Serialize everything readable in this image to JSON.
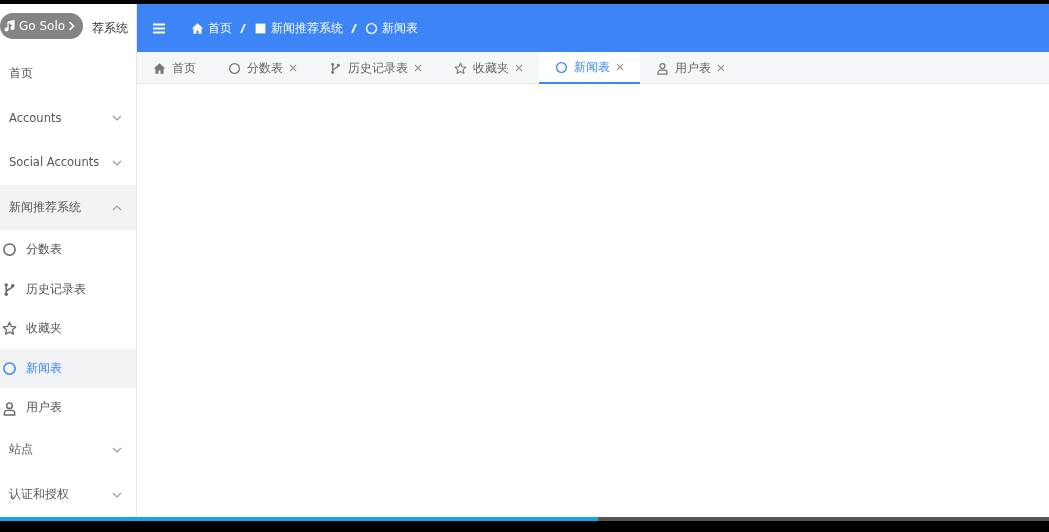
{
  "player_overlay": {
    "label": "Go Solo"
  },
  "sidebar": {
    "title": "荐系统",
    "items": [
      {
        "label": "首页",
        "kind": "link",
        "selected": false
      },
      {
        "label": "Accounts",
        "kind": "group",
        "expanded": false,
        "selected": false
      },
      {
        "label": "Social Accounts",
        "kind": "group",
        "expanded": false,
        "selected": false
      },
      {
        "label": "新闻推荐系统",
        "kind": "group",
        "expanded": true,
        "selected": false,
        "children": [
          {
            "label": "分数表",
            "kind": "circle",
            "selected": false
          },
          {
            "label": "历史记录表",
            "kind": "branch",
            "selected": false
          },
          {
            "label": "收藏夹",
            "kind": "star",
            "selected": false
          },
          {
            "label": "新闻表",
            "kind": "circle",
            "selected": true
          },
          {
            "label": "用户表",
            "kind": "user",
            "selected": false
          }
        ]
      },
      {
        "label": "站点",
        "kind": "group",
        "expanded": false,
        "selected": false
      },
      {
        "label": "认证和授权",
        "kind": "group",
        "expanded": false,
        "selected": false
      }
    ]
  },
  "breadcrumb": [
    {
      "label": "首页",
      "kind": "home"
    },
    {
      "label": "新闻推荐系统",
      "kind": "square"
    },
    {
      "label": "新闻表",
      "kind": "circle"
    }
  ],
  "tabs": [
    {
      "label": "首页",
      "kind": "home",
      "closable": false,
      "selected": false
    },
    {
      "label": "分数表",
      "kind": "circle",
      "closable": true,
      "selected": false
    },
    {
      "label": "历史记录表",
      "kind": "branch",
      "closable": true,
      "selected": false
    },
    {
      "label": "收藏夹",
      "kind": "star",
      "closable": true,
      "selected": false
    },
    {
      "label": "新闻表",
      "kind": "circle",
      "closable": true,
      "selected": true
    },
    {
      "label": "用户表",
      "kind": "user",
      "closable": true,
      "selected": false
    }
  ],
  "video_progress": {
    "level": 0.57
  }
}
